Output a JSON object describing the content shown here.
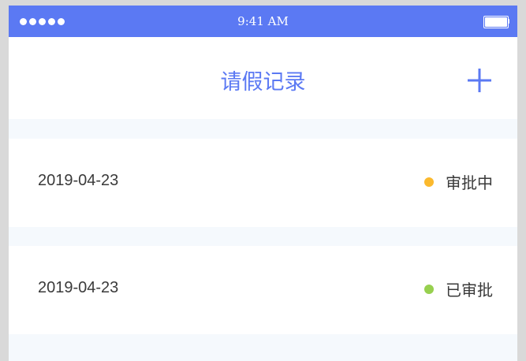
{
  "status_bar": {
    "time": "9:41 AM",
    "background": "#5b79f3"
  },
  "header": {
    "title": "请假记录",
    "add_icon": "plus-icon",
    "accent": "#5b79f3"
  },
  "records": [
    {
      "date": "2019-04-23",
      "status": "审批中",
      "status_color": "#fbb92d"
    },
    {
      "date": "2019-04-23",
      "status": "已审批",
      "status_color": "#97d04f"
    }
  ]
}
